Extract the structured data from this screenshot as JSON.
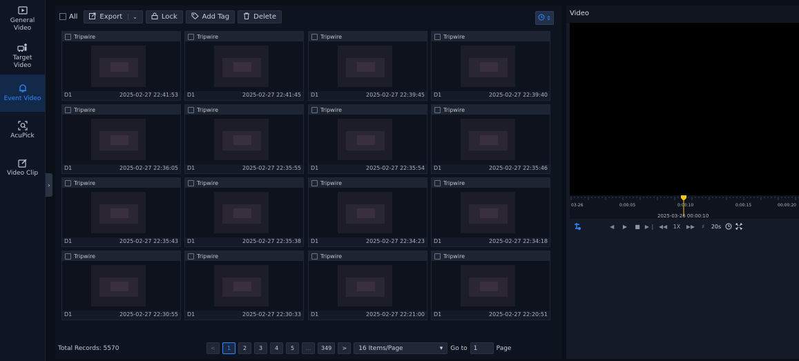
{
  "sidebar": {
    "items": [
      {
        "label": "General Video",
        "icon": "play-square-icon",
        "active": false
      },
      {
        "label": "Target Video",
        "icon": "person-car-icon",
        "active": false
      },
      {
        "label": "Event Video",
        "icon": "bell-icon",
        "active": true
      },
      {
        "label": "AcuPick",
        "icon": "face-scan-icon",
        "active": false
      },
      {
        "label": "Video Clip",
        "icon": "edit-clip-icon",
        "active": false
      }
    ],
    "collapse_glyph": "›"
  },
  "toolbar": {
    "all_label": "All",
    "export_label": "Export",
    "lock_label": "Lock",
    "add_tag_label": "Add Tag",
    "delete_label": "Delete",
    "sort_glyph": "⏲"
  },
  "cards": [
    {
      "tag": "Tripwire",
      "channel": "D1",
      "time": "2025-02-27 22:41:53"
    },
    {
      "tag": "Tripwire",
      "channel": "D1",
      "time": "2025-02-27 22:41:45"
    },
    {
      "tag": "Tripwire",
      "channel": "D1",
      "time": "2025-02-27 22:39:45"
    },
    {
      "tag": "Tripwire",
      "channel": "D1",
      "time": "2025-02-27 22:39:40"
    },
    {
      "tag": "Tripwire",
      "channel": "D1",
      "time": "2025-02-27 22:36:05"
    },
    {
      "tag": "Tripwire",
      "channel": "D1",
      "time": "2025-02-27 22:35:55"
    },
    {
      "tag": "Tripwire",
      "channel": "D1",
      "time": "2025-02-27 22:35:54"
    },
    {
      "tag": "Tripwire",
      "channel": "D1",
      "time": "2025-02-27 22:35:46"
    },
    {
      "tag": "Tripwire",
      "channel": "D1",
      "time": "2025-02-27 22:35:43"
    },
    {
      "tag": "Tripwire",
      "channel": "D1",
      "time": "2025-02-27 22:35:38"
    },
    {
      "tag": "Tripwire",
      "channel": "D1",
      "time": "2025-02-27 22:34:23"
    },
    {
      "tag": "Tripwire",
      "channel": "D1",
      "time": "2025-02-27 22:34:18"
    },
    {
      "tag": "Tripwire",
      "channel": "D1",
      "time": "2025-02-27 22:30:55"
    },
    {
      "tag": "Tripwire",
      "channel": "D1",
      "time": "2025-02-27 22:30:33"
    },
    {
      "tag": "Tripwire",
      "channel": "D1",
      "time": "2025-02-27 22:21:00"
    },
    {
      "tag": "Tripwire",
      "channel": "D1",
      "time": "2025-02-27 22:20:51"
    }
  ],
  "footer": {
    "total_records": "Total Records: 5570",
    "pages": [
      "1",
      "2",
      "3",
      "4",
      "5",
      "...",
      "349"
    ],
    "current_page": "1",
    "prev_glyph": "<",
    "next_glyph": ">",
    "per_page": "16 Items/Page",
    "goto_label": "Go to",
    "goto_value": "1",
    "page_label": "Page"
  },
  "player": {
    "title": "Video",
    "timeline_labels": [
      "03-26",
      "0:00:05",
      "0:00:10",
      "0:00:15",
      "00:00:20"
    ],
    "current_time": "2025-03-26 00:00:10",
    "speed": "1X",
    "interval": "20s"
  },
  "colors": {
    "accent": "#2e89ff",
    "marker": "#f5c518"
  }
}
